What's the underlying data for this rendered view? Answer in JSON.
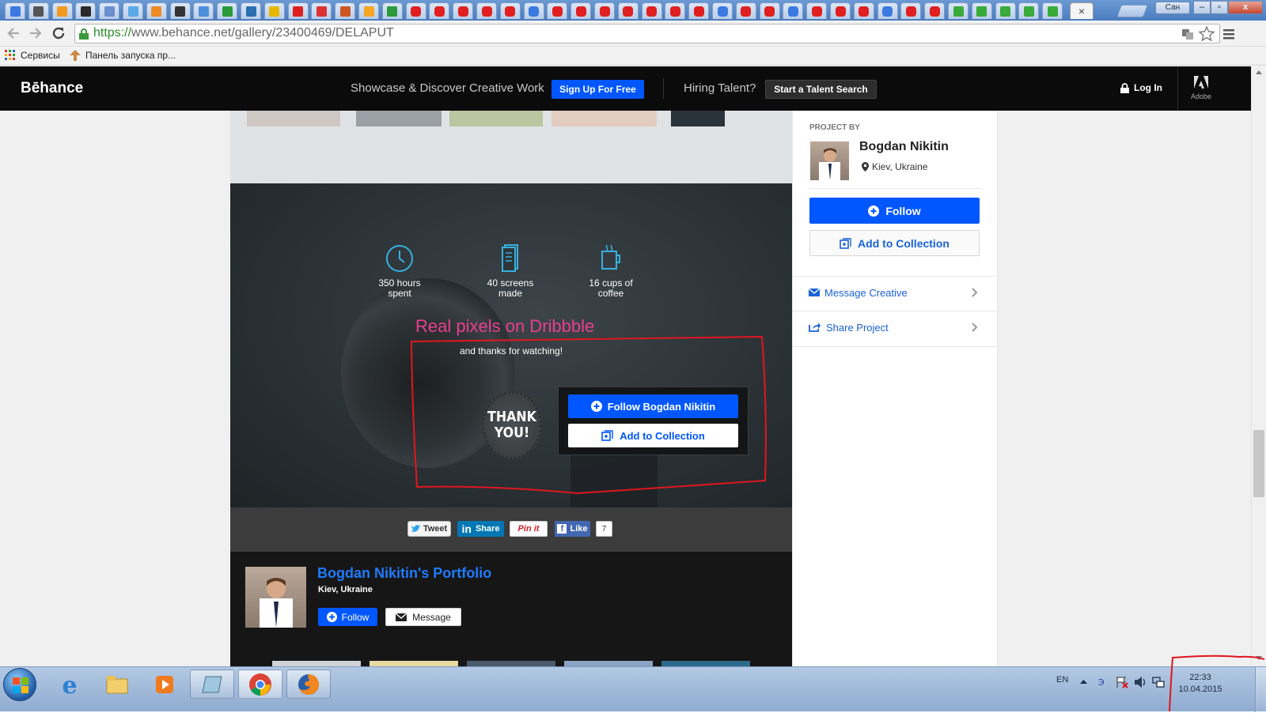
{
  "browser": {
    "tabs_active_close": "×",
    "window_user_label": "Сан",
    "window_controls": {
      "minimize": "–",
      "maximize": "▫",
      "close": "x"
    },
    "url_scheme": "https://",
    "url_rest": "www.behance.net/gallery/23400469/DELAPUT",
    "bookmarks": [
      {
        "icon": "apps-grid-icon",
        "label": "Сервисы"
      },
      {
        "icon": "launcher-icon",
        "label": "Панель запуска пр..."
      }
    ]
  },
  "behance_nav": {
    "logo": "Bēhance",
    "tagline": "Showcase & Discover Creative Work",
    "signup_label": "Sign Up For Free",
    "hiring_label": "Hiring Talent?",
    "talent_search_label": "Start a Talent Search",
    "login_label": "Log In",
    "adobe_label": "Adobe"
  },
  "project": {
    "stats": [
      {
        "icon": "clock-icon",
        "line1": "350 hours",
        "line2": "spent"
      },
      {
        "icon": "screens-icon",
        "line1": "40 screens",
        "line2": "made"
      },
      {
        "icon": "coffee-cup-icon",
        "line1": "16 cups of",
        "line2": "coffee"
      }
    ],
    "annotation_text": "Real pixels on Dribbble",
    "thanks_text": "and thanks for watching!",
    "badge_line1": "THANK",
    "badge_line2": "YOU!",
    "follow_cta_label": "Follow Bogdan Nikitin",
    "add_collection_cta_label": "Add to Collection"
  },
  "share": {
    "tweet_label": "Tweet",
    "linkedin_label": "Share",
    "linkedin_logo": "in",
    "pinterest_label": "Pin it",
    "facebook_label": "Like",
    "facebook_logo": "f",
    "facebook_count": "7"
  },
  "portfolio": {
    "title": "Bogdan Nikitin's Portfolio",
    "location": "Kiev, Ukraine",
    "follow_label": "Follow",
    "message_label": "Message"
  },
  "sidebar": {
    "project_by_label": "PROJECT BY",
    "owner_name": "Bogdan Nikitin",
    "owner_location": "Kiev, Ukraine",
    "follow_label": "Follow",
    "add_collection_label": "Add to Collection",
    "message_label": "Message Creative",
    "share_label": "Share Project"
  },
  "taskbar": {
    "language": "EN",
    "time": "22:33",
    "date": "10.04.2015"
  },
  "colors": {
    "behance_blue": "#0057ff",
    "nav_bg": "#0b0b0b",
    "annotation_pink": "#e93e8f",
    "annotation_red": "#e0161e"
  }
}
